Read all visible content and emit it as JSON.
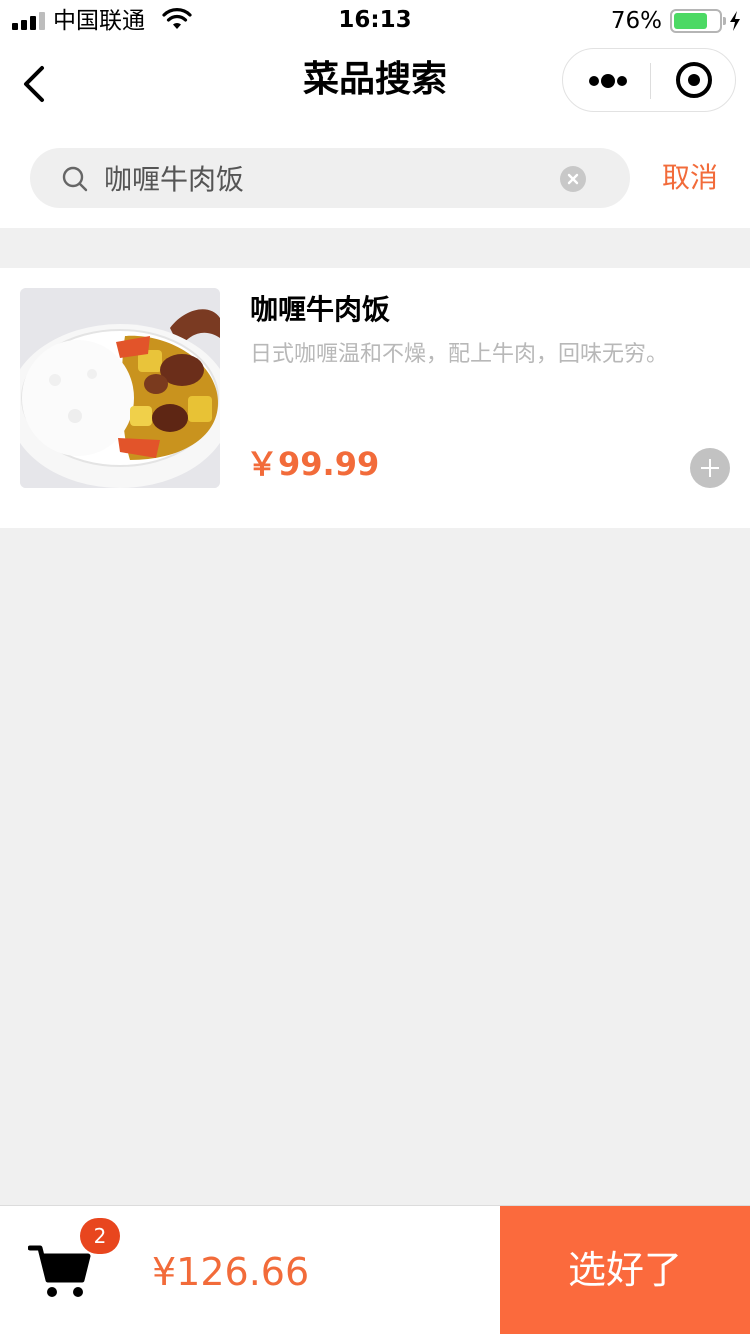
{
  "status_bar": {
    "carrier": "中国联通",
    "time": "16:13",
    "battery_percent": "76%",
    "battery_level": 0.76,
    "battery_color": "#4cd964"
  },
  "nav": {
    "title": "菜品搜索",
    "back_icon": "chevron-left-icon",
    "more_icon": "more-dots-icon",
    "close_icon": "target-close-icon"
  },
  "search": {
    "value": "咖喱牛肉饭",
    "cancel_label": "取消",
    "search_icon": "search-icon",
    "clear_icon": "clear-circle-icon"
  },
  "results": [
    {
      "name": "咖喱牛肉饭",
      "description": "日式咖喱温和不燥，配上牛肉，回味无穷。",
      "price": "￥99.99",
      "add_icon": "plus-circle-icon"
    }
  ],
  "cart": {
    "count": "2",
    "total": "¥126.66",
    "checkout_label": "选好了",
    "cart_icon": "shopping-cart-icon"
  },
  "colors": {
    "accent": "#f26b3a",
    "checkout_bg": "#fb6a3d",
    "badge": "#e8461e",
    "page_bg": "#f0f0f0"
  }
}
